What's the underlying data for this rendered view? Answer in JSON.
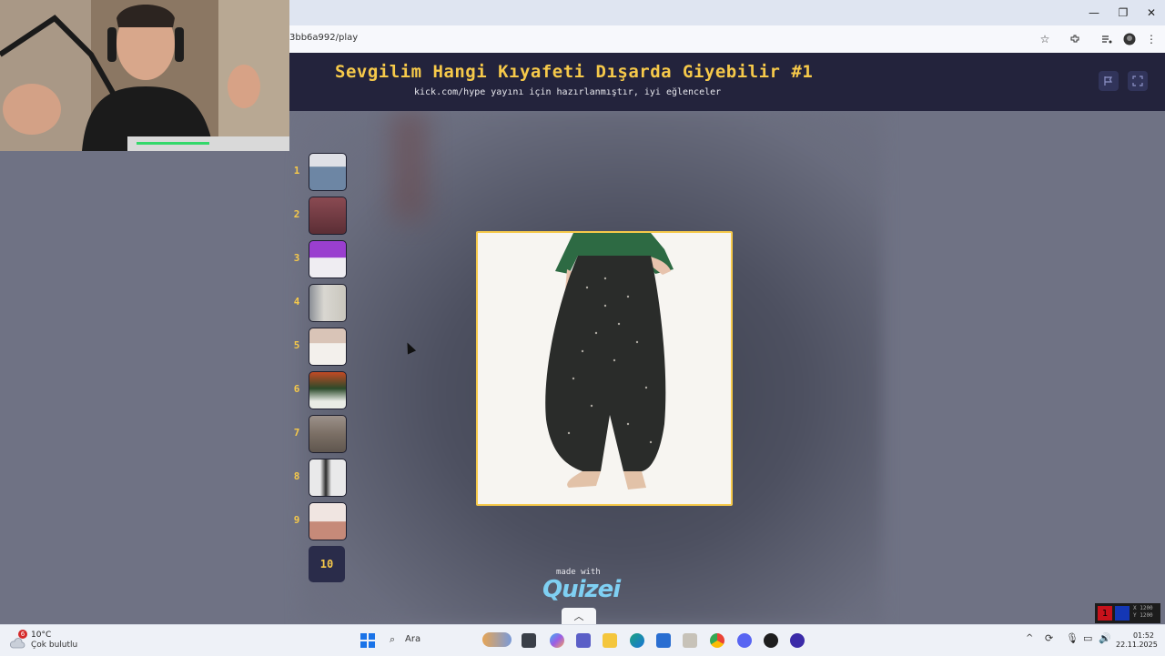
{
  "browser": {
    "url": "3bb6a992/play",
    "window_buttons": [
      "—",
      "❐",
      "✕"
    ]
  },
  "quiz": {
    "title": "Sevgilim Hangi Kıyafeti Dışarda Giyebilir #1",
    "subtitle": "kick.com/hype yayını için hazırlanmıştır, iyi eğlenceler",
    "thumbnails": [
      {
        "num": "1",
        "colors": [
          "#dfe0e6",
          "#6d86a4"
        ]
      },
      {
        "num": "2",
        "colors": [
          "#8a4a52",
          "#5b2e35"
        ]
      },
      {
        "num": "3",
        "colors": [
          "#9a3fcf",
          "#efedf2"
        ]
      },
      {
        "num": "4",
        "colors": [
          "#d9d7d1",
          "#c9c6bd"
        ]
      },
      {
        "num": "5",
        "colors": [
          "#d9c4b7",
          "#f3f0ec"
        ]
      },
      {
        "num": "6",
        "colors": [
          "#c34a24",
          "#2c4a2a"
        ]
      },
      {
        "num": "7",
        "colors": [
          "#7b6f65",
          "#5f564e"
        ]
      },
      {
        "num": "8",
        "colors": [
          "#e9e9ea",
          "#2b2b2b"
        ]
      },
      {
        "num": "9",
        "colors": [
          "#f0e5e1",
          "#c68a79"
        ]
      }
    ],
    "tenth": "10",
    "made_with": "made with",
    "brand": "Quizei"
  },
  "overlay": {
    "counter": "1",
    "line1": "X 1200",
    "line2": "Y 1200"
  },
  "taskbar": {
    "temperature": "10°C",
    "condition": "Çok bulutlu",
    "weather_badge": "6",
    "search_placeholder": "Ara",
    "time": "01:52",
    "date": "22.11.2025"
  },
  "colors": {
    "accent": "#f6c94a",
    "header": "#23233c",
    "page": "#6f7284"
  }
}
